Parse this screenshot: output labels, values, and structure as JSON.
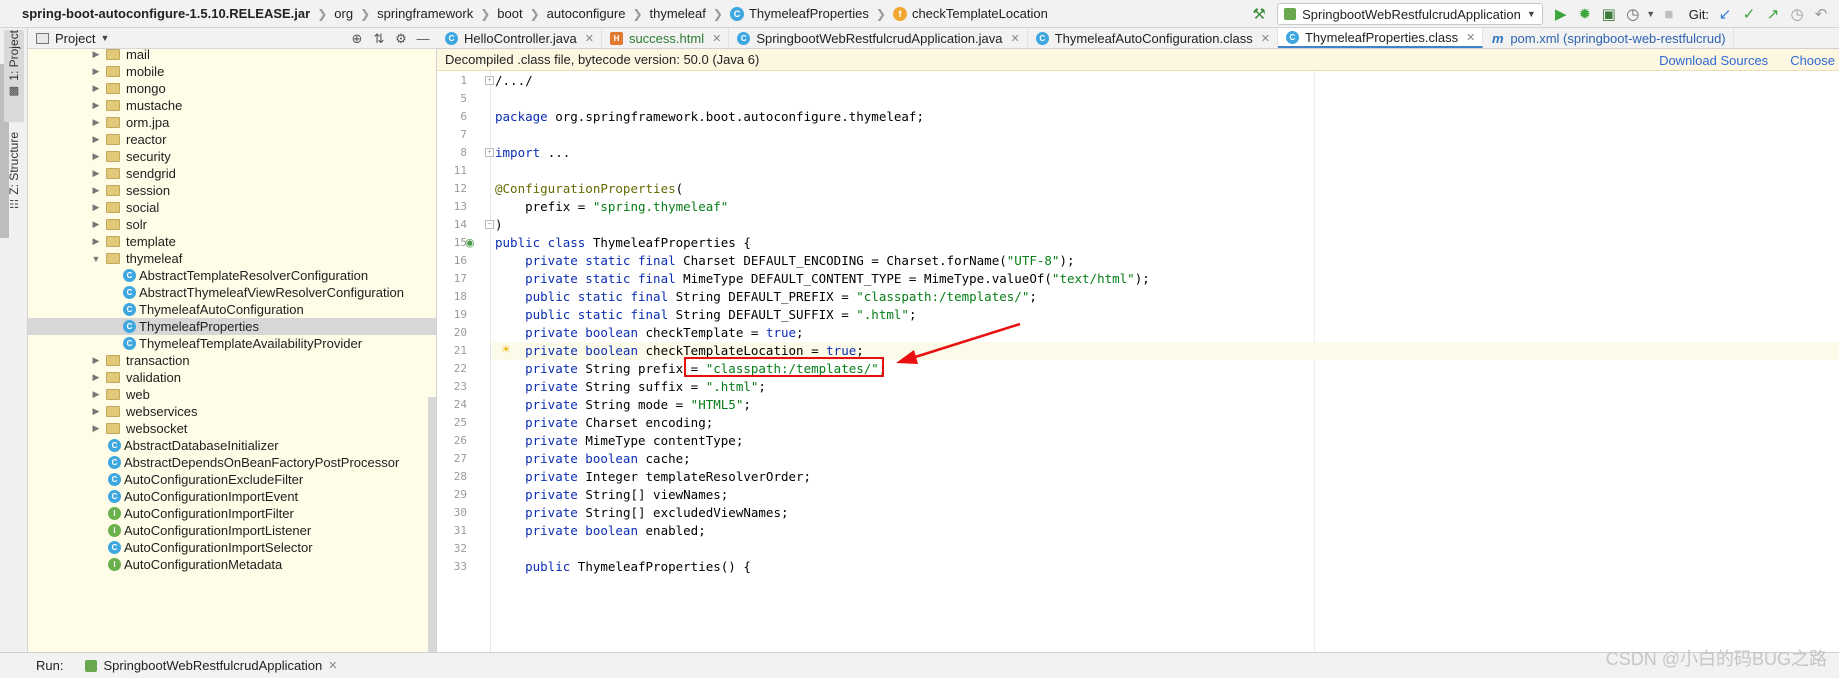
{
  "navbar": {
    "breadcrumbs": [
      {
        "label": "spring-boot-autoconfigure-1.5.10.RELEASE.jar",
        "icon": ""
      },
      {
        "label": "org",
        "icon": ""
      },
      {
        "label": "springframework",
        "icon": ""
      },
      {
        "label": "boot",
        "icon": ""
      },
      {
        "label": "autoconfigure",
        "icon": ""
      },
      {
        "label": "thymeleaf",
        "icon": ""
      },
      {
        "label": "ThymeleafProperties",
        "icon": "class-icon"
      },
      {
        "label": "checkTemplateLocation",
        "icon": "method-icon"
      }
    ],
    "run_config": "SpringbootWebRestfulcrudApplication",
    "git_label": "Git:"
  },
  "left_strip": {
    "project_tab": "1: Project",
    "structure_tab": "Z: Structure"
  },
  "project_panel": {
    "title": "Project",
    "tree": [
      {
        "label": "mail",
        "kind": "folder",
        "depth": 0,
        "expanded": false
      },
      {
        "label": "mobile",
        "kind": "folder",
        "depth": 0,
        "expanded": false
      },
      {
        "label": "mongo",
        "kind": "folder",
        "depth": 0,
        "expanded": false
      },
      {
        "label": "mustache",
        "kind": "folder",
        "depth": 0,
        "expanded": false
      },
      {
        "label": "orm.jpa",
        "kind": "folder",
        "depth": 0,
        "expanded": false
      },
      {
        "label": "reactor",
        "kind": "folder",
        "depth": 0,
        "expanded": false
      },
      {
        "label": "security",
        "kind": "folder",
        "depth": 0,
        "expanded": false
      },
      {
        "label": "sendgrid",
        "kind": "folder",
        "depth": 0,
        "expanded": false
      },
      {
        "label": "session",
        "kind": "folder",
        "depth": 0,
        "expanded": false
      },
      {
        "label": "social",
        "kind": "folder",
        "depth": 0,
        "expanded": false
      },
      {
        "label": "solr",
        "kind": "folder",
        "depth": 0,
        "expanded": false
      },
      {
        "label": "template",
        "kind": "folder",
        "depth": 0,
        "expanded": false
      },
      {
        "label": "thymeleaf",
        "kind": "folder",
        "depth": 0,
        "expanded": true
      },
      {
        "label": "AbstractTemplateResolverConfiguration",
        "kind": "class",
        "depth": 1
      },
      {
        "label": "AbstractThymeleafViewResolverConfiguration",
        "kind": "class",
        "depth": 1
      },
      {
        "label": "ThymeleafAutoConfiguration",
        "kind": "class",
        "depth": 1
      },
      {
        "label": "ThymeleafProperties",
        "kind": "class",
        "depth": 1,
        "selected": true
      },
      {
        "label": "ThymeleafTemplateAvailabilityProvider",
        "kind": "class",
        "depth": 1
      },
      {
        "label": "transaction",
        "kind": "folder",
        "depth": 0,
        "expanded": false
      },
      {
        "label": "validation",
        "kind": "folder",
        "depth": 0,
        "expanded": false
      },
      {
        "label": "web",
        "kind": "folder",
        "depth": 0,
        "expanded": false
      },
      {
        "label": "webservices",
        "kind": "folder",
        "depth": 0,
        "expanded": false
      },
      {
        "label": "websocket",
        "kind": "folder",
        "depth": 0,
        "expanded": false
      },
      {
        "label": "AbstractDatabaseInitializer",
        "kind": "class",
        "depth": 0
      },
      {
        "label": "AbstractDependsOnBeanFactoryPostProcessor",
        "kind": "class",
        "depth": 0
      },
      {
        "label": "AutoConfigurationExcludeFilter",
        "kind": "class",
        "depth": 0
      },
      {
        "label": "AutoConfigurationImportEvent",
        "kind": "class",
        "depth": 0
      },
      {
        "label": "AutoConfigurationImportFilter",
        "kind": "interface",
        "depth": 0
      },
      {
        "label": "AutoConfigurationImportListener",
        "kind": "interface",
        "depth": 0
      },
      {
        "label": "AutoConfigurationImportSelector",
        "kind": "class",
        "depth": 0
      },
      {
        "label": "AutoConfigurationMetadata",
        "kind": "interface",
        "depth": 0
      }
    ]
  },
  "tabs": [
    {
      "label": "HelloController.java",
      "icon": "java-class-icon",
      "style": "normal",
      "active": false
    },
    {
      "label": "success.html",
      "icon": "html-file-icon",
      "style": "green",
      "active": false
    },
    {
      "label": "SpringbootWebRestfulcrudApplication.java",
      "icon": "java-class-icon",
      "style": "normal",
      "active": false
    },
    {
      "label": "ThymeleafAutoConfiguration.class",
      "icon": "class-file-icon",
      "style": "normal",
      "active": false
    },
    {
      "label": "ThymeleafProperties.class",
      "icon": "class-file-icon",
      "style": "normal",
      "active": true
    },
    {
      "label": "pom.xml (springboot-web-restfulcrud)",
      "icon": "maven-icon",
      "style": "blue",
      "active": false
    }
  ],
  "infobar": {
    "text": "Decompiled .class file, bytecode version: 50.0 (Java 6)",
    "download_sources": "Download Sources",
    "choose": "Choose"
  },
  "editor": {
    "lines": [
      {
        "n": "1",
        "tokens": [
          [
            "plain",
            "/.../"
          ]
        ]
      },
      {
        "n": "5",
        "tokens": []
      },
      {
        "n": "6",
        "tokens": [
          [
            "kw",
            "package "
          ],
          [
            "plain",
            "org.springframework.boot.autoconfigure.thymeleaf;"
          ]
        ]
      },
      {
        "n": "7",
        "tokens": []
      },
      {
        "n": "8",
        "tokens": [
          [
            "kw",
            "import "
          ],
          [
            "plain",
            "..."
          ]
        ]
      },
      {
        "n": "11",
        "tokens": []
      },
      {
        "n": "12",
        "tokens": [
          [
            "ann",
            "@ConfigurationProperties"
          ],
          [
            "plain",
            "("
          ]
        ]
      },
      {
        "n": "13",
        "tokens": [
          [
            "plain",
            "    prefix = "
          ],
          [
            "str",
            "\"spring.thymeleaf\""
          ]
        ]
      },
      {
        "n": "14",
        "tokens": [
          [
            "plain",
            ")"
          ]
        ]
      },
      {
        "n": "15",
        "tokens": [
          [
            "kw",
            "public class "
          ],
          [
            "plain",
            "ThymeleafProperties {"
          ]
        ]
      },
      {
        "n": "16",
        "tokens": [
          [
            "kw",
            "    private static final "
          ],
          [
            "plain",
            "Charset DEFAULT_ENCODING = Charset.forName("
          ],
          [
            "str",
            "\"UTF-8\""
          ],
          [
            "plain",
            ");"
          ]
        ]
      },
      {
        "n": "17",
        "tokens": [
          [
            "kw",
            "    private static final "
          ],
          [
            "plain",
            "MimeType DEFAULT_CONTENT_TYPE = MimeType.valueOf("
          ],
          [
            "str",
            "\"text/html\""
          ],
          [
            "plain",
            ");"
          ]
        ]
      },
      {
        "n": "18",
        "tokens": [
          [
            "kw",
            "    public static final "
          ],
          [
            "plain",
            "String DEFAULT_PREFIX = "
          ],
          [
            "str",
            "\"classpath:/templates/\""
          ],
          [
            "plain",
            ";"
          ]
        ]
      },
      {
        "n": "19",
        "tokens": [
          [
            "kw",
            "    public static final "
          ],
          [
            "plain",
            "String DEFAULT_SUFFIX = "
          ],
          [
            "str",
            "\".html\""
          ],
          [
            "plain",
            ";"
          ]
        ]
      },
      {
        "n": "20",
        "tokens": [
          [
            "kw",
            "    private boolean "
          ],
          [
            "plain",
            "checkTemplate = "
          ],
          [
            "kw",
            "true"
          ],
          [
            "plain",
            ";"
          ]
        ]
      },
      {
        "n": "21",
        "tokens": [
          [
            "kw",
            "    private boolean "
          ],
          [
            "plain",
            "checkTemplateLocation = "
          ],
          [
            "kw",
            "true"
          ],
          [
            "plain",
            ";"
          ]
        ]
      },
      {
        "n": "22",
        "tokens": [
          [
            "kw",
            "    private "
          ],
          [
            "plain",
            "String prefix = "
          ],
          [
            "str",
            "\"classpath:/templates/\""
          ],
          [
            "plain",
            ";"
          ]
        ]
      },
      {
        "n": "23",
        "tokens": [
          [
            "kw",
            "    private "
          ],
          [
            "plain",
            "String suffix = "
          ],
          [
            "str",
            "\".html\""
          ],
          [
            "plain",
            ";"
          ]
        ]
      },
      {
        "n": "24",
        "tokens": [
          [
            "kw",
            "    private "
          ],
          [
            "plain",
            "String mode = "
          ],
          [
            "str",
            "\"HTML5\""
          ],
          [
            "plain",
            ";"
          ]
        ]
      },
      {
        "n": "25",
        "tokens": [
          [
            "kw",
            "    private "
          ],
          [
            "plain",
            "Charset encoding;"
          ]
        ]
      },
      {
        "n": "26",
        "tokens": [
          [
            "kw",
            "    private "
          ],
          [
            "plain",
            "MimeType contentType;"
          ]
        ]
      },
      {
        "n": "27",
        "tokens": [
          [
            "kw",
            "    private boolean "
          ],
          [
            "plain",
            "cache;"
          ]
        ]
      },
      {
        "n": "28",
        "tokens": [
          [
            "kw",
            "    private "
          ],
          [
            "plain",
            "Integer templateResolverOrder;"
          ]
        ]
      },
      {
        "n": "29",
        "tokens": [
          [
            "kw",
            "    private "
          ],
          [
            "plain",
            "String[] viewNames;"
          ]
        ]
      },
      {
        "n": "30",
        "tokens": [
          [
            "kw",
            "    private "
          ],
          [
            "plain",
            "String[] excludedViewNames;"
          ]
        ]
      },
      {
        "n": "31",
        "tokens": [
          [
            "kw",
            "    private boolean "
          ],
          [
            "plain",
            "enabled;"
          ]
        ]
      },
      {
        "n": "32",
        "tokens": []
      },
      {
        "n": "33",
        "tokens": [
          [
            "kw",
            "    public "
          ],
          [
            "plain",
            "ThymeleafProperties() {"
          ]
        ]
      }
    ]
  },
  "runbar": {
    "label": "Run:",
    "tab": "SpringbootWebRestfulcrudApplication"
  },
  "watermark": "CSDN @小白的码BUG之路",
  "colors": {
    "keyword": "#0b2db3",
    "string": "#067d17",
    "annotation": "#676a00",
    "highlight_box": "#e81010",
    "tree_background": "#fffde7"
  }
}
